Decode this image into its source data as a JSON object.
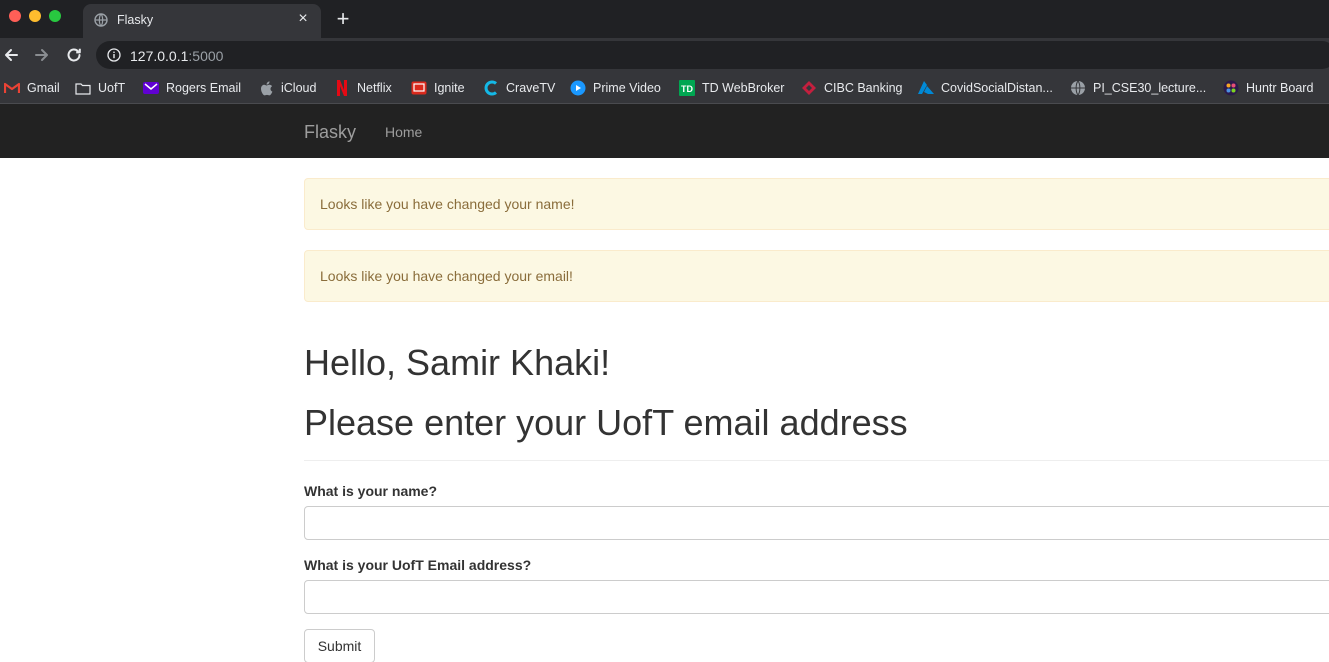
{
  "browser": {
    "tab_title": "Flasky",
    "tab_close": "×",
    "new_tab": "+",
    "url_host": "127.0.0.1",
    "url_port": ":5000"
  },
  "bookmarks": [
    {
      "label": "Gmail",
      "icon": "gmail-icon"
    },
    {
      "label": "UofT",
      "icon": "folder-icon"
    },
    {
      "label": "Rogers Email",
      "icon": "rogers-email-icon"
    },
    {
      "label": "iCloud",
      "icon": "apple-icon"
    },
    {
      "label": "Netflix",
      "icon": "netflix-icon"
    },
    {
      "label": "Ignite",
      "icon": "ignite-icon"
    },
    {
      "label": "CraveTV",
      "icon": "cravetv-icon"
    },
    {
      "label": "Prime Video",
      "icon": "prime-video-icon"
    },
    {
      "label": "TD WebBroker",
      "icon": "td-icon"
    },
    {
      "label": "CIBC Banking",
      "icon": "cibc-icon"
    },
    {
      "label": "CovidSocialDistan...",
      "icon": "azure-icon"
    },
    {
      "label": "PI_CSE30_lecture...",
      "icon": "globe-icon"
    },
    {
      "label": "Huntr Board",
      "icon": "huntr-icon"
    }
  ],
  "navbar": {
    "brand": "Flasky",
    "home": "Home"
  },
  "alerts": [
    "Looks like you have changed your name!",
    "Looks like you have changed your email!"
  ],
  "main": {
    "greeting": "Hello, Samir Khaki!",
    "subtitle": "Please enter your UofT email address"
  },
  "form": {
    "name_label": "What is your name?",
    "name_value": "",
    "email_label": "What is your UofT Email address?",
    "email_value": "",
    "submit_label": "Submit"
  }
}
